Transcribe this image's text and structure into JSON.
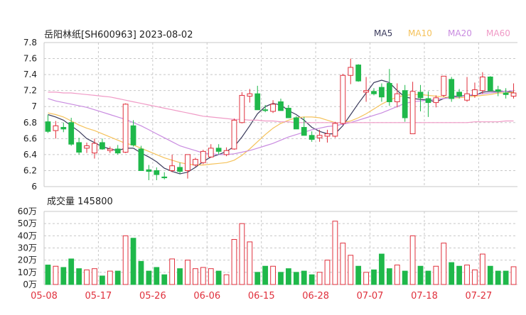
{
  "header": {
    "title": "岳阳林纸[SH600963] 2023-08-02",
    "legend": [
      {
        "label": "MA5",
        "color": "#3a3a5c"
      },
      {
        "label": "MA10",
        "color": "#f5c25b"
      },
      {
        "label": "MA20",
        "color": "#c98be0"
      },
      {
        "label": "MA60",
        "color": "#f09ac6"
      }
    ]
  },
  "volume_label": "成交量 145800",
  "colors": {
    "up": "#e0303c",
    "down": "#1fb84a",
    "grid": "#c8c8c8",
    "text": "#222222"
  },
  "chart_data": [
    {
      "type": "candlestick",
      "ylim": [
        6.0,
        7.8
      ],
      "yticks": [
        "7.8",
        "7.6",
        "7.4",
        "7.2",
        "7",
        "6.8",
        "6.6",
        "6.4",
        "6.2",
        "6"
      ],
      "dates": [
        "05-08",
        "05-09",
        "05-10",
        "05-11",
        "05-12",
        "05-15",
        "05-16",
        "05-17",
        "05-18",
        "05-19",
        "05-22",
        "05-23",
        "05-24",
        "05-25",
        "05-26",
        "05-29",
        "05-30",
        "05-31",
        "06-01",
        "06-02",
        "06-05",
        "06-06",
        "06-07",
        "06-08",
        "06-09",
        "06-12",
        "06-13",
        "06-14",
        "06-15",
        "06-16",
        "06-19",
        "06-20",
        "06-21",
        "06-26",
        "06-27",
        "06-28",
        "06-29",
        "06-30",
        "07-03",
        "07-04",
        "07-05",
        "07-06",
        "07-07",
        "07-10",
        "07-11",
        "07-12",
        "07-13",
        "07-14",
        "07-17",
        "07-18",
        "07-19",
        "07-20",
        "07-21",
        "07-24",
        "07-25",
        "07-26",
        "07-27",
        "07-28",
        "07-31",
        "08-01",
        "08-02"
      ],
      "ohlc": [
        [
          6.81,
          6.9,
          6.67,
          6.69
        ],
        [
          6.7,
          6.82,
          6.6,
          6.76
        ],
        [
          6.74,
          6.8,
          6.68,
          6.72
        ],
        [
          6.8,
          6.86,
          6.51,
          6.53
        ],
        [
          6.55,
          6.61,
          6.4,
          6.43
        ],
        [
          6.48,
          6.55,
          6.42,
          6.51
        ],
        [
          6.42,
          6.6,
          6.35,
          6.54
        ],
        [
          6.55,
          6.6,
          6.46,
          6.47
        ],
        [
          6.45,
          6.5,
          6.42,
          6.47
        ],
        [
          6.47,
          6.52,
          6.4,
          6.42
        ],
        [
          6.43,
          7.04,
          6.42,
          7.03
        ],
        [
          6.76,
          6.83,
          6.5,
          6.52
        ],
        [
          6.47,
          6.51,
          6.2,
          6.2
        ],
        [
          6.21,
          6.27,
          6.08,
          6.19
        ],
        [
          6.2,
          6.24,
          6.08,
          6.15
        ],
        [
          6.12,
          6.18,
          6.09,
          6.11
        ],
        [
          6.2,
          6.4,
          6.18,
          6.26
        ],
        [
          6.24,
          6.3,
          6.16,
          6.19
        ],
        [
          6.2,
          6.36,
          6.1,
          6.4
        ],
        [
          6.27,
          6.36,
          6.25,
          6.34
        ],
        [
          6.3,
          6.46,
          6.28,
          6.44
        ],
        [
          6.37,
          6.53,
          6.36,
          6.48
        ],
        [
          6.48,
          6.53,
          6.4,
          6.44
        ],
        [
          6.4,
          6.49,
          6.38,
          6.45
        ],
        [
          6.47,
          6.85,
          6.46,
          6.83
        ],
        [
          6.8,
          7.18,
          6.79,
          7.14
        ],
        [
          7.13,
          7.22,
          7.05,
          7.16
        ],
        [
          7.16,
          7.26,
          6.99,
          6.96
        ],
        [
          6.96,
          7.02,
          6.93,
          6.95
        ],
        [
          6.94,
          7.08,
          6.92,
          7.03
        ],
        [
          7.06,
          7.1,
          6.95,
          6.95
        ],
        [
          6.98,
          7.02,
          6.86,
          6.86
        ],
        [
          6.86,
          6.88,
          6.72,
          6.72
        ],
        [
          6.74,
          6.87,
          6.69,
          6.64
        ],
        [
          6.64,
          6.69,
          6.56,
          6.59
        ],
        [
          6.61,
          6.71,
          6.56,
          6.64
        ],
        [
          6.63,
          6.71,
          6.55,
          6.66
        ],
        [
          6.63,
          6.81,
          6.61,
          6.79
        ],
        [
          6.79,
          7.41,
          6.77,
          7.39
        ],
        [
          7.39,
          7.6,
          7.28,
          7.49
        ],
        [
          7.52,
          7.53,
          7.31,
          7.32
        ],
        [
          7.18,
          7.37,
          7.06,
          7.2
        ],
        [
          7.19,
          7.23,
          7.14,
          7.16
        ],
        [
          7.24,
          7.29,
          7.06,
          7.12
        ],
        [
          7.29,
          7.47,
          7.01,
          7.06
        ],
        [
          7.06,
          7.29,
          6.99,
          7.16
        ],
        [
          7.2,
          7.27,
          6.81,
          6.86
        ],
        [
          6.66,
          7.31,
          6.66,
          7.19
        ],
        [
          7.18,
          7.27,
          6.94,
          7.11
        ],
        [
          7.1,
          7.19,
          6.87,
          7.05
        ],
        [
          7.05,
          7.14,
          6.99,
          7.11
        ],
        [
          7.14,
          7.37,
          7.12,
          7.38
        ],
        [
          7.34,
          7.37,
          7.06,
          7.1
        ],
        [
          7.18,
          7.22,
          7.1,
          7.13
        ],
        [
          7.08,
          7.37,
          7.06,
          7.16
        ],
        [
          7.14,
          7.3,
          7.11,
          7.21
        ],
        [
          7.2,
          7.43,
          7.16,
          7.37
        ],
        [
          7.37,
          7.38,
          7.21,
          7.2
        ],
        [
          7.21,
          7.26,
          7.13,
          7.19
        ],
        [
          7.17,
          7.23,
          7.1,
          7.15
        ],
        [
          7.13,
          7.29,
          7.1,
          7.17
        ]
      ],
      "ma5": [
        6.9,
        6.87,
        6.83,
        6.76,
        6.69,
        6.6,
        6.55,
        6.5,
        6.47,
        6.45,
        6.48,
        6.48,
        6.42,
        6.37,
        6.31,
        6.23,
        6.19,
        6.16,
        6.18,
        6.24,
        6.31,
        6.37,
        6.4,
        6.44,
        6.5,
        6.62,
        6.76,
        6.91,
        7.0,
        7.04,
        7.02,
        6.95,
        6.9,
        6.83,
        6.74,
        6.69,
        6.66,
        6.66,
        6.76,
        6.9,
        7.04,
        7.17,
        7.3,
        7.33,
        7.3,
        7.2,
        7.12,
        7.1,
        7.09,
        7.08,
        7.06,
        7.1,
        7.13,
        7.13,
        7.14,
        7.14,
        7.18,
        7.19,
        7.19,
        7.19,
        7.18
      ],
      "ma10": [
        6.92,
        6.9,
        6.87,
        6.82,
        6.77,
        6.73,
        6.7,
        6.66,
        6.62,
        6.58,
        6.54,
        6.52,
        6.48,
        6.44,
        6.4,
        6.36,
        6.33,
        6.3,
        6.28,
        6.27,
        6.27,
        6.28,
        6.29,
        6.3,
        6.33,
        6.39,
        6.47,
        6.56,
        6.65,
        6.73,
        6.79,
        6.83,
        6.86,
        6.87,
        6.87,
        6.86,
        6.83,
        6.8,
        6.8,
        6.82,
        6.86,
        6.91,
        6.97,
        7.03,
        7.08,
        7.12,
        7.14,
        7.15,
        7.15,
        7.14,
        7.13,
        7.12,
        7.11,
        7.11,
        7.12,
        7.13,
        7.14,
        7.15,
        7.17,
        7.17,
        7.18
      ],
      "ma20": [
        7.1,
        7.07,
        7.05,
        7.03,
        7.01,
        6.99,
        6.96,
        6.93,
        6.9,
        6.87,
        6.84,
        6.8,
        6.76,
        6.71,
        6.66,
        6.61,
        6.56,
        6.51,
        6.48,
        6.45,
        6.42,
        6.41,
        6.4,
        6.4,
        6.41,
        6.43,
        6.45,
        6.48,
        6.51,
        6.54,
        6.58,
        6.62,
        6.65,
        6.68,
        6.71,
        6.73,
        6.75,
        6.76,
        6.78,
        6.8,
        6.83,
        6.86,
        6.89,
        6.92,
        6.96,
        7.0,
        7.04,
        7.06,
        7.07,
        7.08,
        7.09,
        7.1,
        7.11,
        7.12,
        7.14,
        7.15,
        7.16,
        7.17,
        7.18,
        7.19,
        7.2
      ],
      "ma60": [
        7.18,
        7.18,
        7.17,
        7.17,
        7.16,
        7.15,
        7.14,
        7.13,
        7.12,
        7.1,
        7.08,
        7.06,
        7.04,
        7.02,
        7.0,
        6.98,
        6.96,
        6.94,
        6.92,
        6.9,
        6.88,
        6.87,
        6.86,
        6.85,
        6.84,
        6.84,
        6.83,
        6.83,
        6.82,
        6.82,
        6.81,
        6.81,
        6.8,
        6.8,
        6.8,
        6.8,
        6.8,
        6.8,
        6.8,
        6.8,
        6.8,
        6.8,
        6.8,
        6.8,
        6.8,
        6.8,
        6.8,
        6.8,
        6.8,
        6.8,
        6.8,
        6.8,
        6.8,
        6.8,
        6.8,
        6.81,
        6.81,
        6.81,
        6.81,
        6.82,
        6.82
      ]
    },
    {
      "type": "bar",
      "title": "成交量 145800",
      "ylim": [
        0,
        600000
      ],
      "yticks": [
        "60万",
        "50万",
        "40万",
        "30万",
        "20万",
        "10万",
        "0万"
      ],
      "xticks": [
        "05-08",
        "05-17",
        "05-26",
        "06-06",
        "06-15",
        "06-28",
        "07-07",
        "07-18",
        "07-27"
      ],
      "volumes": [
        160000,
        150000,
        140000,
        210000,
        130000,
        120000,
        130000,
        70000,
        110000,
        110000,
        400000,
        380000,
        190000,
        110000,
        140000,
        80000,
        210000,
        130000,
        200000,
        130000,
        140000,
        130000,
        110000,
        80000,
        370000,
        500000,
        350000,
        100000,
        150000,
        150000,
        100000,
        130000,
        100000,
        110000,
        80000,
        100000,
        200000,
        520000,
        340000,
        240000,
        150000,
        100000,
        120000,
        250000,
        130000,
        160000,
        110000,
        400000,
        150000,
        110000,
        150000,
        340000,
        180000,
        150000,
        160000,
        120000,
        250000,
        150000,
        110000,
        110000,
        145800
      ]
    }
  ]
}
